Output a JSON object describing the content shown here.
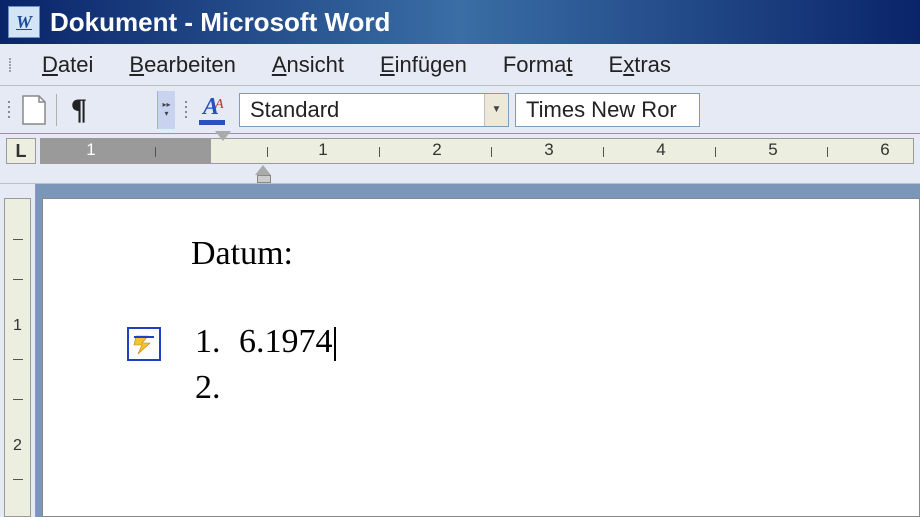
{
  "titlebar": {
    "title": "Dokument - Microsoft Word"
  },
  "menu": {
    "file": {
      "label": "Datei",
      "mnemonic": "D"
    },
    "edit": {
      "label": "Bearbeiten",
      "mnemonic": "B"
    },
    "view": {
      "label": "Ansicht",
      "mnemonic": "A"
    },
    "insert": {
      "label": "Einfügen",
      "mnemonic": "E"
    },
    "format": {
      "label": "Format",
      "mnemonic": "t"
    },
    "extras": {
      "label": "Extras",
      "mnemonic": "x"
    }
  },
  "toolbar": {
    "style_value": "Standard",
    "font_value": "Times New Ror"
  },
  "ruler": {
    "gray_left": "1",
    "marks": [
      "1",
      "2",
      "3",
      "4",
      "5",
      "6"
    ]
  },
  "vruler": {
    "marks": [
      "1",
      "2"
    ]
  },
  "document": {
    "heading": "Datum:",
    "list": [
      {
        "num": "1.",
        "text": "6.1974"
      },
      {
        "num": "2.",
        "text": ""
      }
    ]
  }
}
